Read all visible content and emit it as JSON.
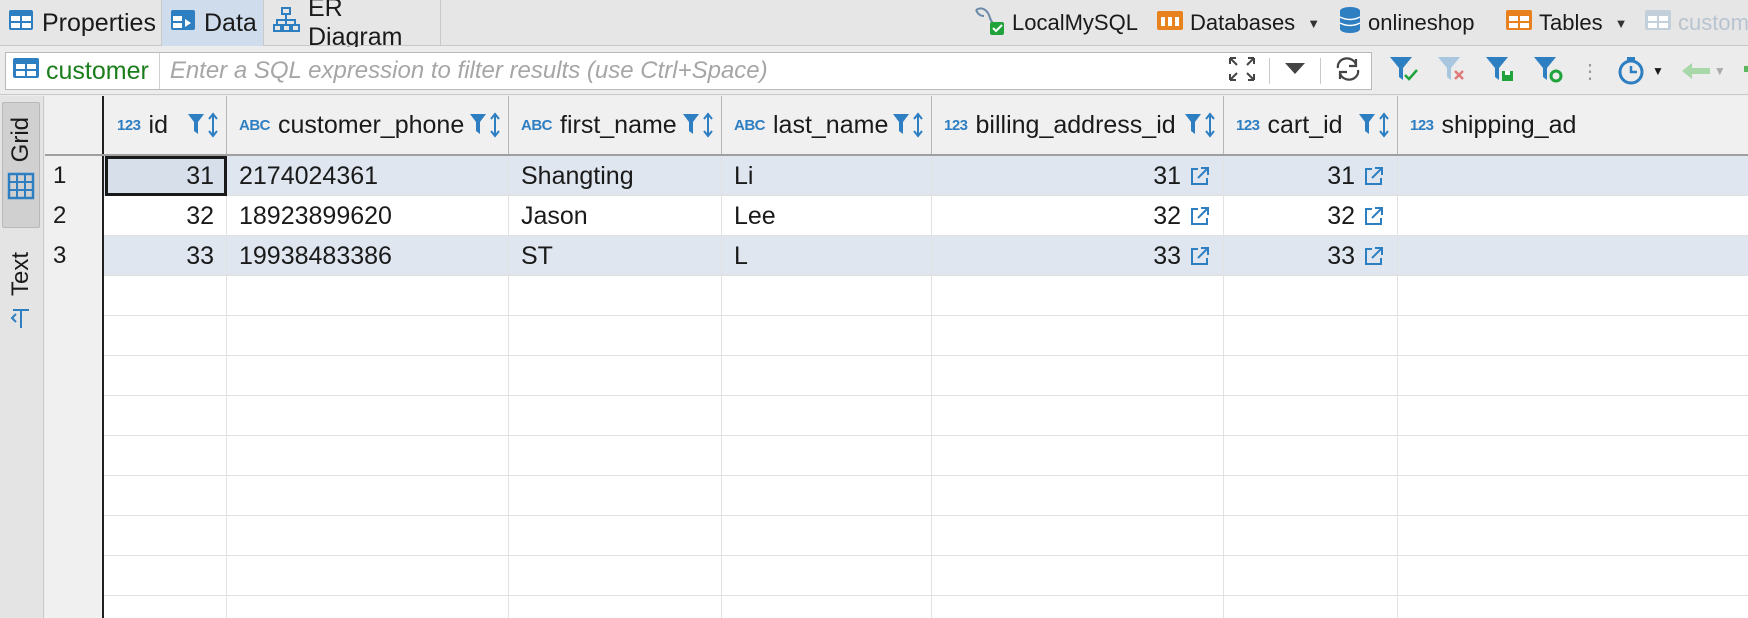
{
  "tabs": [
    {
      "label": "Properties",
      "icon": "properties-icon",
      "active": false
    },
    {
      "label": "Data",
      "icon": "data-grid-icon",
      "active": true
    },
    {
      "label": "ER Diagram",
      "icon": "er-diagram-icon",
      "active": false
    }
  ],
  "breadcrumbs": {
    "connection": "LocalMySQL",
    "databases": "Databases",
    "database": "onlineshop",
    "tables": "Tables",
    "table": "custom"
  },
  "filter": {
    "table_name": "customer",
    "placeholder": "Enter a SQL expression to filter results (use Ctrl+Space)"
  },
  "side_tabs": {
    "grid": "Grid",
    "text": "Text"
  },
  "columns": [
    {
      "type": "123",
      "name": "id"
    },
    {
      "type": "ABC",
      "name": "customer_phone"
    },
    {
      "type": "ABC",
      "name": "first_name"
    },
    {
      "type": "ABC",
      "name": "last_name"
    },
    {
      "type": "123",
      "name": "billing_address_id"
    },
    {
      "type": "123",
      "name": "cart_id"
    },
    {
      "type": "123",
      "name": "shipping_ad"
    }
  ],
  "rows": [
    {
      "n": "1",
      "id": "31",
      "customer_phone": "2174024361",
      "first_name": "Shangting",
      "last_name": "Li",
      "billing_address_id": "31",
      "cart_id": "31"
    },
    {
      "n": "2",
      "id": "32",
      "customer_phone": "18923899620",
      "first_name": "Jason",
      "last_name": "Lee",
      "billing_address_id": "32",
      "cart_id": "32"
    },
    {
      "n": "3",
      "id": "33",
      "customer_phone": "19938483386",
      "first_name": "ST",
      "last_name": "L",
      "billing_address_id": "33",
      "cart_id": "33"
    }
  ],
  "colors": {
    "accent_blue": "#2e7ec2",
    "table_green": "#1b7d1b",
    "selected_row": "#dfe6ef",
    "active_tab": "#cfdcec",
    "db_orange": "#e8821e"
  }
}
